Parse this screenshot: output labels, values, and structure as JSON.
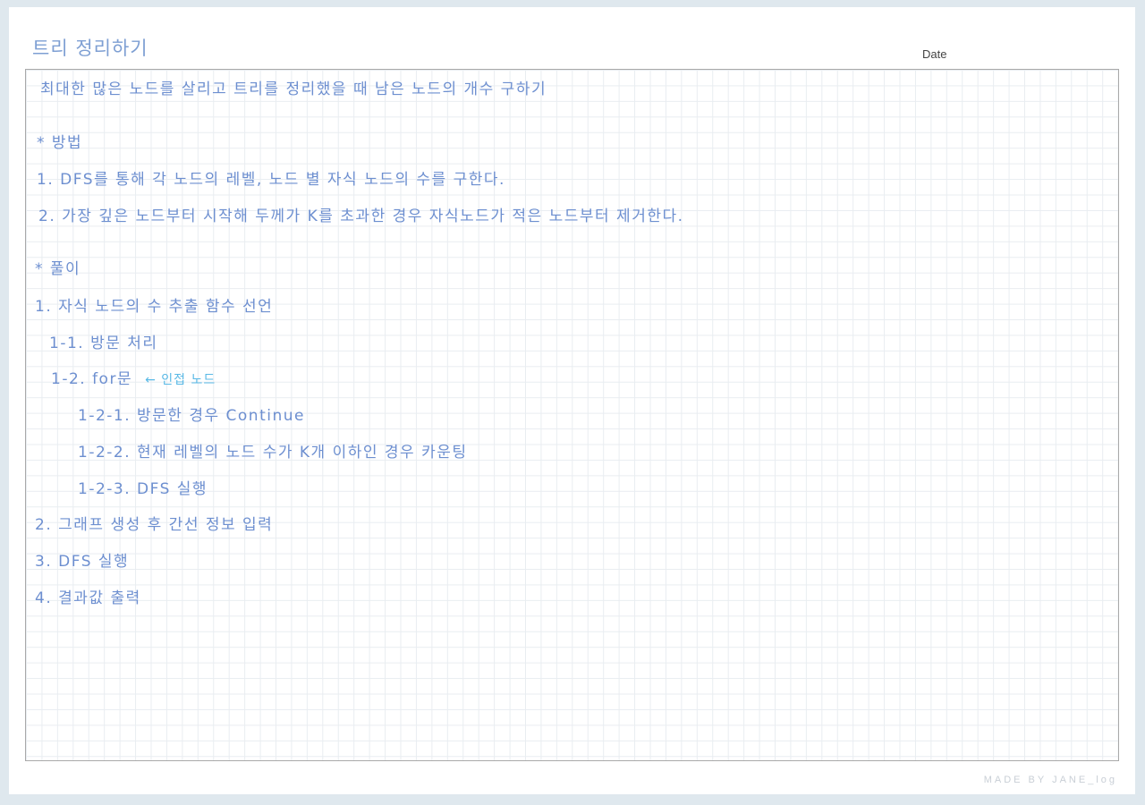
{
  "header": {
    "title": "트리 정리하기",
    "date_label": "Date"
  },
  "notes": {
    "problem": "최대한 많은 노드를 살리고 트리를 정리했을 때 남은 노드의 개수 구하기",
    "method_heading": "* 방법",
    "method_1": "1. DFS를 통해 각 노드의 레벨, 노드 별 자식 노드의 수를 구한다.",
    "method_2": "2. 가장 깊은 노드부터 시작해 두께가 K를 초과한 경우 자식노드가 적은 노드부터 제거한다.",
    "solution_heading": "* 풀이",
    "step_1": "1. 자식 노드의 수 추출 함수 선언",
    "step_1_1": "1-1. 방문 처리",
    "step_1_2": "1-2. for문",
    "step_1_2_note": "← 인접 노드",
    "step_1_2_1": "1-2-1. 방문한 경우 Continue",
    "step_1_2_2": "1-2-2. 현재 레벨의 노드 수가 K개 이하인 경우 카운팅",
    "step_1_2_3": "1-2-3. DFS 실행",
    "step_2": "2. 그래프 생성 후 간선 정보 입력",
    "step_3": "3. DFS 실행",
    "step_4": "4. 결과값 출력"
  },
  "footer": {
    "credit": "MADE BY JANE_log"
  },
  "colors": {
    "ink": "#6d8fd0",
    "highlight_ink": "#59b9e6",
    "title_ink": "#7e9fd3",
    "page_border": "#dfe8ee"
  }
}
